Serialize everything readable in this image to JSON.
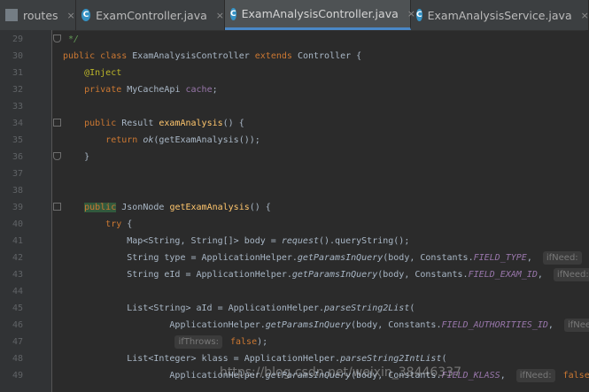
{
  "tabs": [
    {
      "label": "routes",
      "active": false,
      "icon": "file-icon"
    },
    {
      "label": "ExamController.java",
      "active": false,
      "icon": "class-icon"
    },
    {
      "label": "ExamAnalysisController.java",
      "active": true,
      "icon": "class-icon"
    },
    {
      "label": "ExamAnalysisService.java",
      "active": false,
      "icon": "class-icon"
    }
  ],
  "class_icon_letter": "C",
  "close_glyph": "×",
  "code_lines": [
    {
      "n": "29",
      "t": " */"
    },
    {
      "n": "30",
      "t": "public class ExamAnalysisController extends Controller {"
    },
    {
      "n": "31",
      "t": "    @Inject"
    },
    {
      "n": "32",
      "t": "    private MyCacheApi cache;"
    },
    {
      "n": "33",
      "t": ""
    },
    {
      "n": "34",
      "t": "    public Result examAnalysis() {"
    },
    {
      "n": "35",
      "t": "        return ok(getExamAnalysis());"
    },
    {
      "n": "36",
      "t": "    }"
    },
    {
      "n": "37",
      "t": ""
    },
    {
      "n": "38",
      "t": ""
    },
    {
      "n": "39",
      "t": "    public JsonNode getExamAnalysis() {"
    },
    {
      "n": "40",
      "t": "        try {"
    },
    {
      "n": "41",
      "t": "            Map<String, String[]> body = request().queryString();"
    },
    {
      "n": "42",
      "t": "            String type = ApplicationHelper.getParamsInQuery(body, Constants.FIELD_TYPE,  ifNeed: tr"
    },
    {
      "n": "43",
      "t": "            String eId = ApplicationHelper.getParamsInQuery(body, Constants.FIELD_EXAM_ID,  ifNeed:"
    },
    {
      "n": "44",
      "t": ""
    },
    {
      "n": "45",
      "t": "            List<String> aId = ApplicationHelper.parseString2List("
    },
    {
      "n": "46",
      "t": "                    ApplicationHelper.getParamsInQuery(body, Constants.FIELD_AUTHORITIES_ID,  ifNee"
    },
    {
      "n": "47",
      "t": "                     ifThrows: false);"
    },
    {
      "n": "48",
      "t": "            List<Integer> klass = ApplicationHelper.parseString2IntList("
    },
    {
      "n": "49",
      "t": "                    ApplicationHelper.getParamsInQuery(body, Constants.FIELD_KLASS,  ifNeed: false"
    }
  ],
  "watermark": "https://blog.csdn.net/weixin_38446337"
}
